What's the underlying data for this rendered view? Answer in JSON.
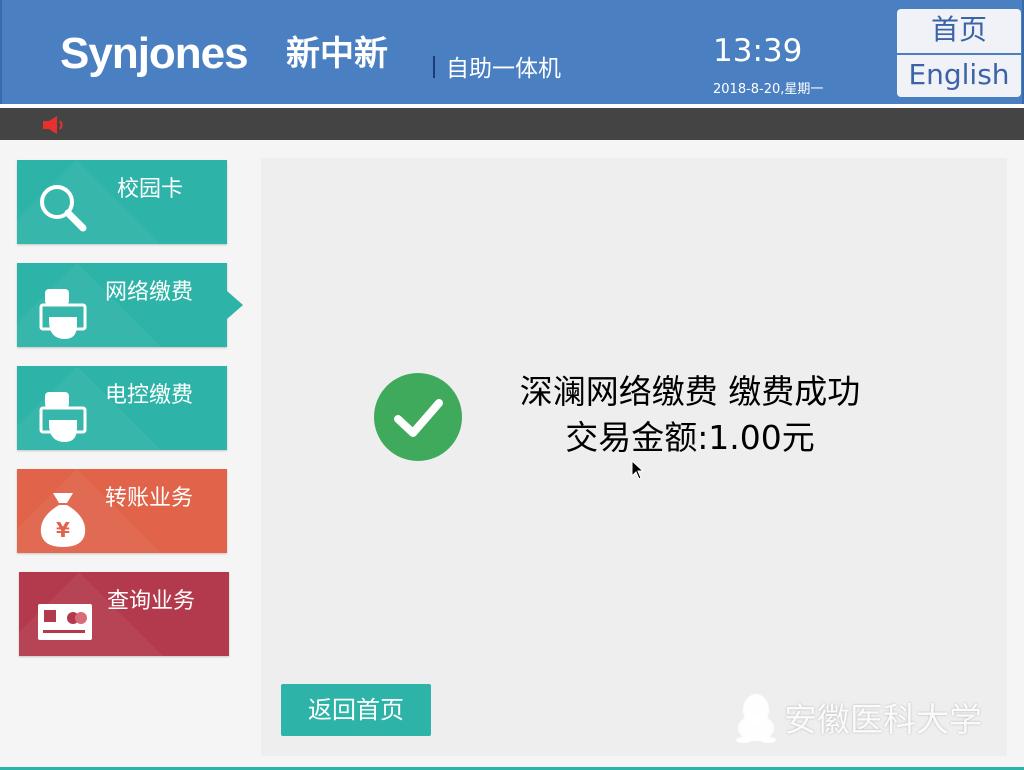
{
  "header": {
    "logo_text": "Synjones",
    "logo_cn": "新中新",
    "subtitle": "自助一体机",
    "time": "13:39",
    "date": "2018-8-20,星期一",
    "home_label": "首页",
    "english_label": "English"
  },
  "notice": {
    "icon": "speaker-icon"
  },
  "sidebar": {
    "items": [
      {
        "label": "校园卡",
        "icon": "search-icon",
        "color": "#2db3a7"
      },
      {
        "label": "网络缴费",
        "icon": "hand-card-icon",
        "color": "#2db3a7",
        "active": true
      },
      {
        "label": "电控缴费",
        "icon": "hand-card-icon",
        "color": "#2db3a7"
      },
      {
        "label": "转账业务",
        "icon": "money-bag-icon",
        "color": "#e0634a"
      },
      {
        "label": "查询业务",
        "icon": "bank-card-icon",
        "color": "#b33a4c"
      }
    ]
  },
  "main": {
    "success_line1": "深澜网络缴费 缴费成功",
    "success_line2": "交易金额:1.00元",
    "back_label": "返回首页",
    "watermark": "安徽医科大学",
    "success_color": "#3fa95c"
  }
}
